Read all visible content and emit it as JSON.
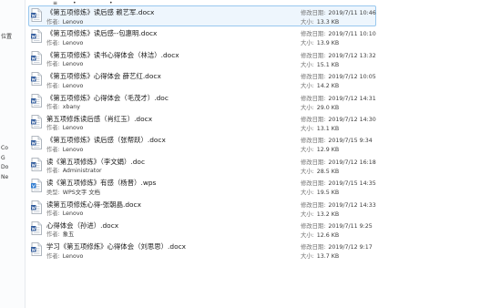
{
  "top_fragments": [
    "≡",
    "•",
    "•"
  ],
  "left_fragments": [
    "位置",
    "Co",
    "G",
    "Do",
    "Ne"
  ],
  "labels": {
    "author": "作者:",
    "type": "类型:",
    "modified": "修改日期:",
    "size": "大小:"
  },
  "files": [
    {
      "name": "《第五项修炼》读后感  赖艺军.docx",
      "sub_label_key": "author",
      "sub": "Lenovo",
      "modified": "2019/7/11 10:46",
      "size": "13.3 KB",
      "icon": "word-doc-icon",
      "selected": true
    },
    {
      "name": "《第五项修炼》读后感--包惠明.docx",
      "sub_label_key": "author",
      "sub": "Lenovo",
      "modified": "2019/7/11 10:10",
      "size": "13.9 KB",
      "icon": "word-doc-icon",
      "selected": false
    },
    {
      "name": "《第五项修炼》读书心得体会（林洁）.docx",
      "sub_label_key": "author",
      "sub": "Lenovo",
      "modified": "2019/7/12 13:32",
      "size": "15.1 KB",
      "icon": "word-doc-icon",
      "selected": false
    },
    {
      "name": "《第五项修炼》心得体会  薛艺红.docx",
      "sub_label_key": "author",
      "sub": "Lenovo",
      "modified": "2019/7/12 10:05",
      "size": "14.2 KB",
      "icon": "word-doc-icon",
      "selected": false
    },
    {
      "name": "《第五项修炼》心得体会（毛茂才）.doc",
      "sub_label_key": "author",
      "sub": "xbany",
      "modified": "2019/7/12 14:31",
      "size": "29.0 KB",
      "icon": "word-doc-icon",
      "selected": false
    },
    {
      "name": "第五项修炼读后感（肖红玉）.docx",
      "sub_label_key": "author",
      "sub": "Lenovo",
      "modified": "2019/7/12 14:30",
      "size": "13.1 KB",
      "icon": "word-doc-icon",
      "selected": false
    },
    {
      "name": "《第五项修炼》读后感（张帮跃）.docx",
      "sub_label_key": "author",
      "sub": "Lenovo",
      "modified": "2019/7/15 9:34",
      "size": "12.9 KB",
      "icon": "word-doc-icon",
      "selected": false
    },
    {
      "name": "读《第五项修炼》（李文娟）.doc",
      "sub_label_key": "author",
      "sub": "Administrator",
      "modified": "2019/7/12 16:18",
      "size": "28.5 KB",
      "icon": "word-doc-icon",
      "selected": false
    },
    {
      "name": "读《第五项修炼》有感（杨晋）.wps",
      "sub_label_key": "type",
      "sub": "WPS文字 文档",
      "modified": "2019/7/15 14:35",
      "size": "19.5 KB",
      "icon": "wps-doc-icon",
      "selected": false
    },
    {
      "name": "读第五项修炼心得-张朝晶.docx",
      "sub_label_key": "author",
      "sub": "Lenovo",
      "modified": "2019/7/12 14:33",
      "size": "13.2 KB",
      "icon": "word-doc-icon",
      "selected": false
    },
    {
      "name": "心得体会（孙进）.docx",
      "sub_label_key": "author",
      "sub": "象五",
      "modified": "2019/7/11 9:25",
      "size": "12.6 KB",
      "icon": "word-doc-icon",
      "selected": false
    },
    {
      "name": "学习《第五项修炼》心得体会（刘思思）.docx",
      "sub_label_key": "author",
      "sub": "Lenovo",
      "modified": "2019/7/12 9:17",
      "size": "13.7 KB",
      "icon": "word-doc-icon",
      "selected": false
    }
  ]
}
